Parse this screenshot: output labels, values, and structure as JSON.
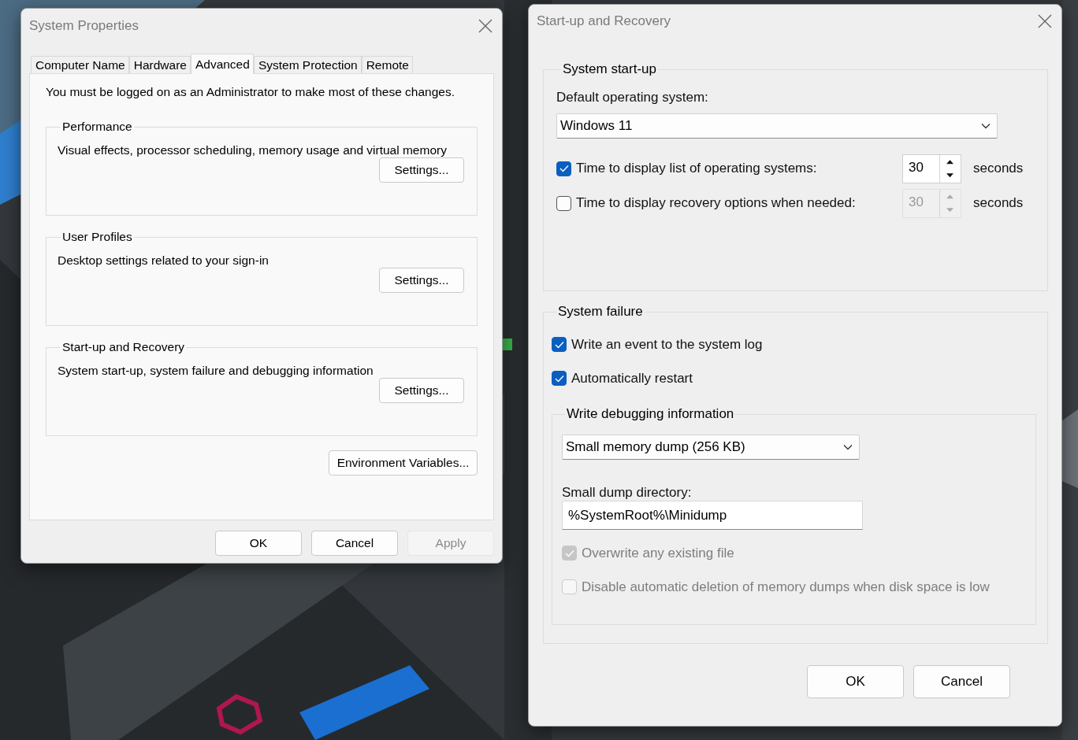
{
  "system_properties": {
    "title": "System Properties",
    "tabs": [
      {
        "label": "Computer Name",
        "selected": false
      },
      {
        "label": "Hardware",
        "selected": false
      },
      {
        "label": "Advanced",
        "selected": true
      },
      {
        "label": "System Protection",
        "selected": false
      },
      {
        "label": "Remote",
        "selected": false
      }
    ],
    "notice": "You must be logged on as an Administrator to make most of these changes.",
    "groups": [
      {
        "legend": "Performance",
        "description": "Visual effects, processor scheduling, memory usage and virtual memory",
        "button": "Settings..."
      },
      {
        "legend": "User Profiles",
        "description": "Desktop settings related to your sign-in",
        "button": "Settings..."
      },
      {
        "legend": "Start-up and Recovery",
        "description": "System start-up, system failure and debugging information",
        "button": "Settings..."
      }
    ],
    "environment_button": "Environment Variables...",
    "buttons": [
      {
        "label": "OK",
        "disabled": false
      },
      {
        "label": "Cancel",
        "disabled": false
      },
      {
        "label": "Apply",
        "disabled": true
      }
    ]
  },
  "startup_recovery": {
    "title": "Start-up and Recovery",
    "system_startup": {
      "legend": "System start-up",
      "default_os_label": "Default operating system:",
      "default_os": "Windows 11",
      "rows": [
        {
          "label": "Time to display list of operating systems:",
          "checked": true,
          "value": "30",
          "unit": "seconds"
        },
        {
          "label": "Time to display recovery options when needed:",
          "checked": false,
          "value": "30",
          "unit": "seconds"
        }
      ]
    },
    "system_failure": {
      "legend": "System failure",
      "checks": [
        {
          "label": "Write an event to the system log",
          "checked": true,
          "disabled": false
        },
        {
          "label": "Automatically restart",
          "checked": true,
          "disabled": false
        }
      ],
      "debug": {
        "legend": "Write debugging information",
        "dump_type": "Small memory dump (256 KB)",
        "dir_label": "Small dump directory:",
        "dir_value": "%SystemRoot%\\Minidump",
        "checks": [
          {
            "label": "Overwrite any existing file",
            "checked": true,
            "disabled": true
          },
          {
            "label": "Disable automatic deletion of memory dumps when disk space is low",
            "checked": false,
            "disabled": true
          }
        ]
      }
    },
    "buttons": [
      "OK",
      "Cancel"
    ]
  }
}
